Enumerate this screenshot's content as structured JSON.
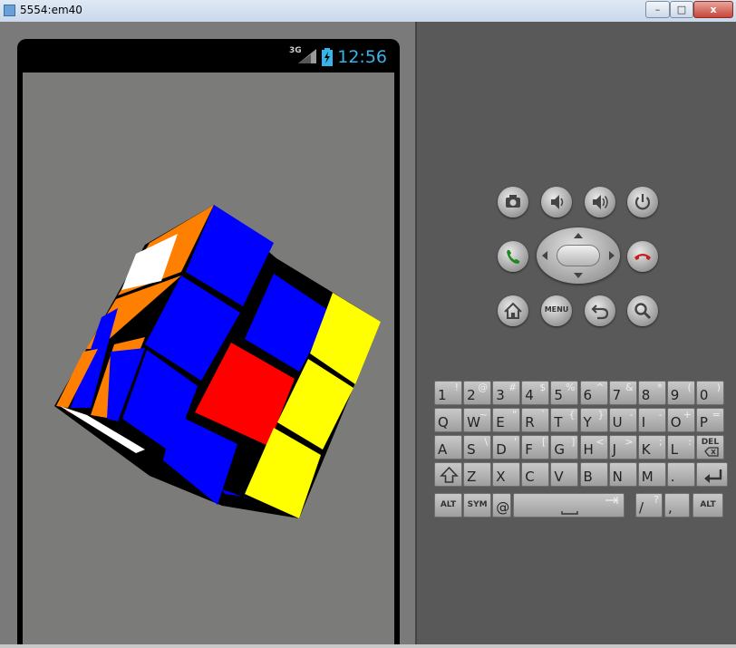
{
  "window": {
    "title": "5554:em40",
    "minimize_label": "–",
    "maximize_label": "□",
    "close_label": "x"
  },
  "statusbar": {
    "network": "3G",
    "clock": "12:56"
  },
  "controls": {
    "menu_label": "MENU"
  },
  "keyboard": {
    "row1": [
      {
        "main": "1",
        "alt": "!"
      },
      {
        "main": "2",
        "alt": "@"
      },
      {
        "main": "3",
        "alt": "#"
      },
      {
        "main": "4",
        "alt": "$"
      },
      {
        "main": "5",
        "alt": "%"
      },
      {
        "main": "6",
        "alt": "^"
      },
      {
        "main": "7",
        "alt": "&"
      },
      {
        "main": "8",
        "alt": "*"
      },
      {
        "main": "9",
        "alt": "("
      },
      {
        "main": "0",
        "alt": ")"
      }
    ],
    "row2": [
      {
        "main": "Q",
        "alt": ""
      },
      {
        "main": "W",
        "alt": "~"
      },
      {
        "main": "E",
        "alt": "\""
      },
      {
        "main": "R",
        "alt": "`"
      },
      {
        "main": "T",
        "alt": "{"
      },
      {
        "main": "Y",
        "alt": "}"
      },
      {
        "main": "U",
        "alt": "-"
      },
      {
        "main": "I",
        "alt": "-"
      },
      {
        "main": "O",
        "alt": "+"
      },
      {
        "main": "P",
        "alt": "="
      }
    ],
    "row3": [
      {
        "main": "A",
        "alt": ""
      },
      {
        "main": "S",
        "alt": "\\"
      },
      {
        "main": "D",
        "alt": "'"
      },
      {
        "main": "F",
        "alt": "["
      },
      {
        "main": "G",
        "alt": "]"
      },
      {
        "main": "H",
        "alt": "<"
      },
      {
        "main": "J",
        "alt": ">"
      },
      {
        "main": "K",
        "alt": ";"
      },
      {
        "main": "L",
        "alt": ":"
      },
      {
        "main": "DEL",
        "alt": ""
      }
    ],
    "row4": [
      {
        "main": "Z",
        "alt": ""
      },
      {
        "main": "X",
        "alt": ""
      },
      {
        "main": "C",
        "alt": ""
      },
      {
        "main": "V",
        "alt": ""
      },
      {
        "main": "B",
        "alt": ""
      },
      {
        "main": "N",
        "alt": ""
      },
      {
        "main": "M",
        "alt": ""
      },
      {
        "main": ".",
        "alt": ""
      }
    ],
    "row5": {
      "alt_left": "ALT",
      "sym": "SYM",
      "at": "@",
      "slash": "/",
      "slash_alt": "?",
      "comma": ",",
      "alt_right": "ALT"
    }
  },
  "colors": {
    "cube_blue": "#0000ff",
    "cube_red": "#ff0000",
    "cube_yellow": "#ffff00",
    "cube_orange": "#ff7f00",
    "cube_white": "#ffffff",
    "screen_bg": "#7b7c7a",
    "clock": "#35b5e8"
  }
}
